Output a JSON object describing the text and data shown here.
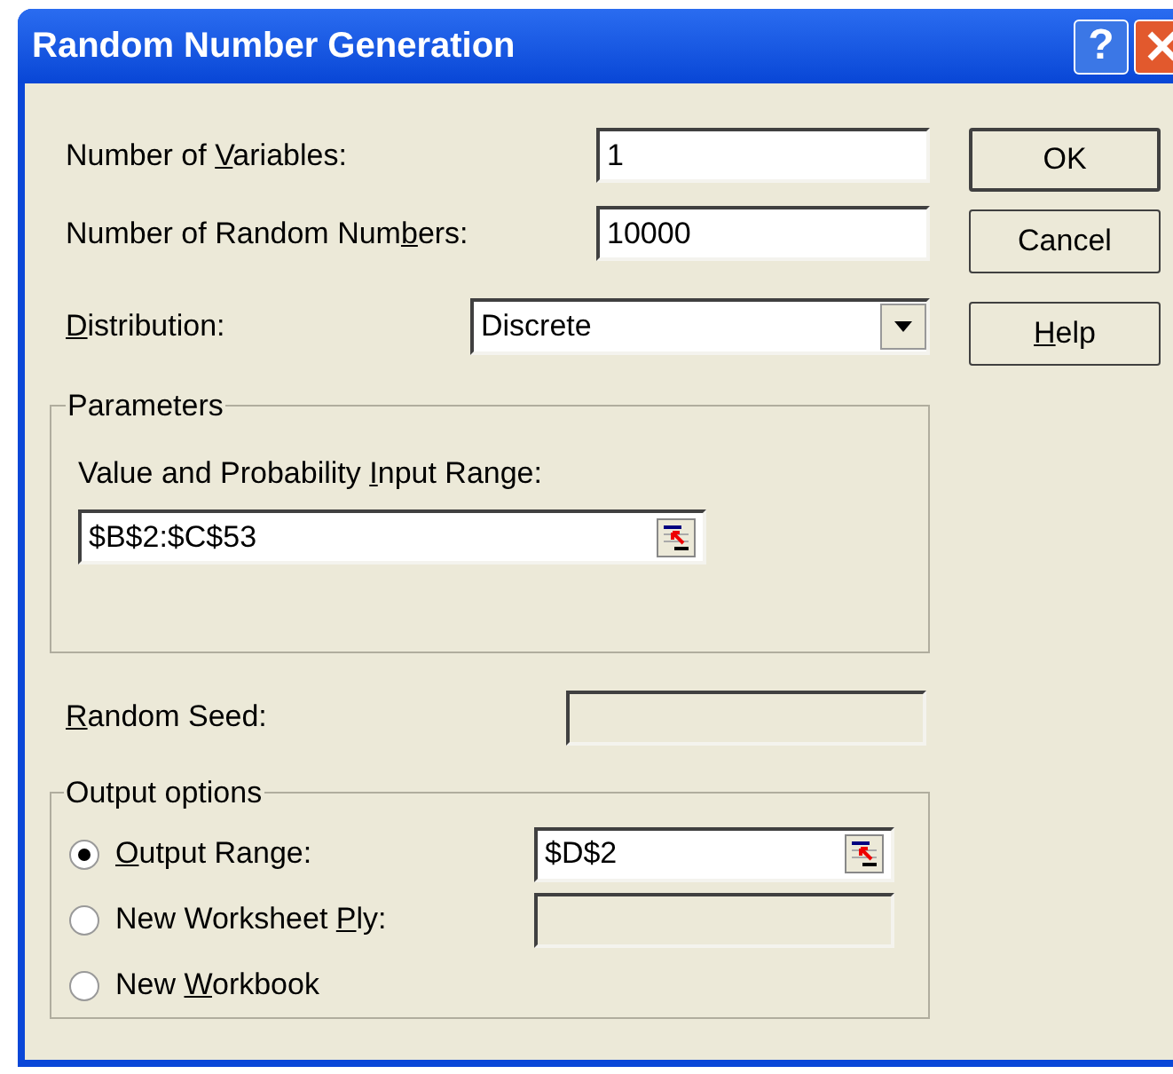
{
  "window": {
    "title": "Random Number Generation",
    "title_buttons": [
      {
        "kind": "help",
        "label": "?"
      },
      {
        "kind": "close"
      }
    ]
  },
  "fields": [
    {
      "label": {
        "before": "Number of ",
        "key": "V",
        "after": "ariables:"
      },
      "value": "1"
    },
    {
      "label": {
        "before": "Number of Random Num",
        "key": "b",
        "after": "ers:"
      },
      "value": "10000"
    }
  ],
  "distribution": {
    "label": {
      "key": "D",
      "after": "istribution:"
    },
    "value": "Discrete"
  },
  "buttons": [
    {
      "label": {
        "after": "OK"
      },
      "default": true
    },
    {
      "label": {
        "after": "Cancel"
      },
      "default": false
    },
    {
      "label": {
        "key": "H",
        "after": "elp"
      },
      "default": false
    }
  ],
  "parameters": {
    "title": "Parameters",
    "label": {
      "before": "Value and Probability ",
      "key": "I",
      "after": "nput Range:"
    },
    "value": "$B$2:$C$53"
  },
  "random_seed": {
    "label": {
      "key": "R",
      "after": "andom Seed:"
    },
    "disabled": true
  },
  "output_options": {
    "title": "Output options",
    "options": [
      {
        "label": {
          "key": "O",
          "after": "utput Range:"
        },
        "selected": true,
        "kind": "range",
        "value": "$D$2",
        "disabled": false
      },
      {
        "label": {
          "before": "New Worksheet ",
          "key": "P",
          "after": "ly:"
        },
        "selected": false,
        "kind": "text",
        "disabled": true
      },
      {
        "label": {
          "before": "New ",
          "key": "W",
          "after": "orkbook"
        },
        "selected": false,
        "kind": "none"
      }
    ]
  }
}
